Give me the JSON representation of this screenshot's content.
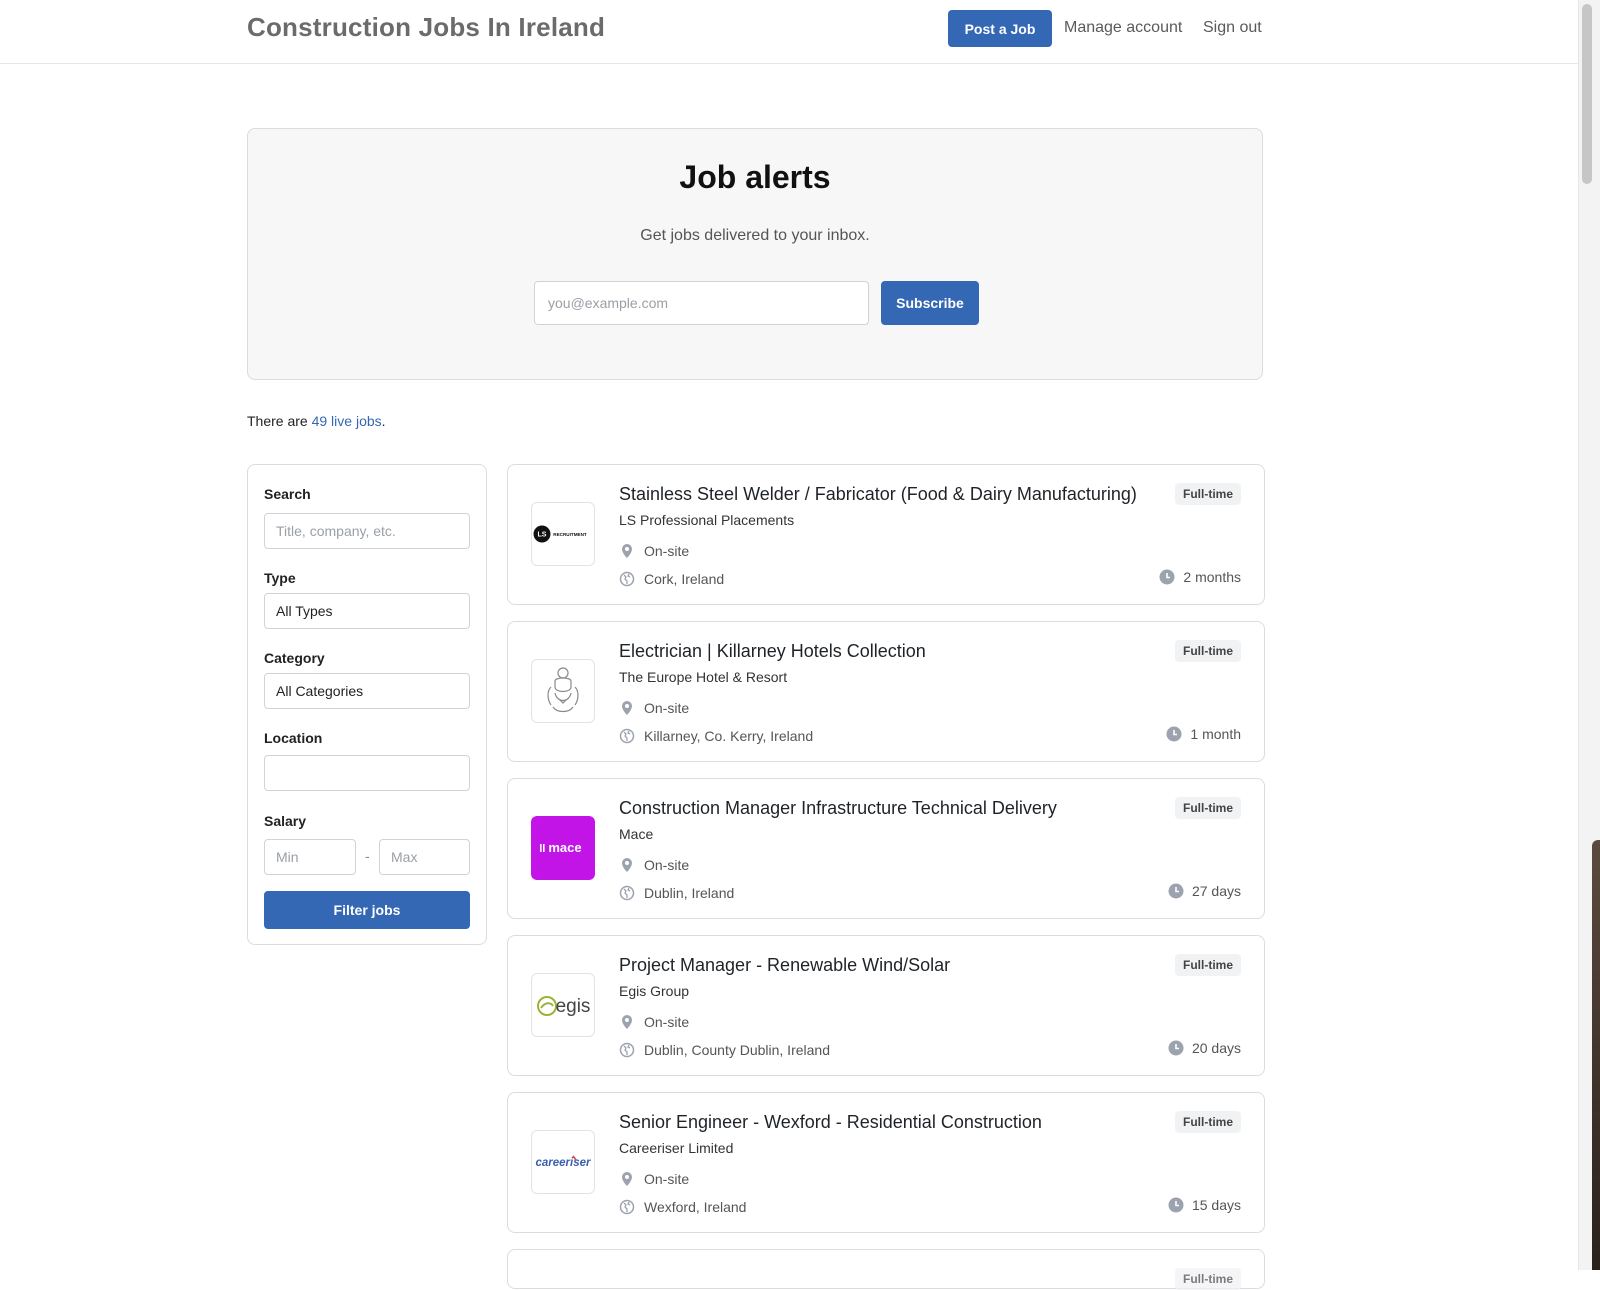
{
  "header": {
    "site_title": "Construction Jobs In Ireland",
    "post_job": "Post a Job",
    "manage_account": "Manage account",
    "sign_out": "Sign out"
  },
  "alerts": {
    "title": "Job alerts",
    "subtitle": "Get jobs delivered to your inbox.",
    "email_placeholder": "you@example.com",
    "subscribe": "Subscribe"
  },
  "summary": {
    "prefix": "There are ",
    "link": "49 live jobs",
    "suffix": "."
  },
  "filters": {
    "search_label": "Search",
    "search_placeholder": "Title, company, etc.",
    "type_label": "Type",
    "type_value": "All Types",
    "category_label": "Category",
    "category_value": "All Categories",
    "location_label": "Location",
    "location_value": "",
    "salary_label": "Salary",
    "min_placeholder": "Min",
    "max_placeholder": "Max",
    "separator": "-",
    "filter_button": "Filter jobs"
  },
  "jobs": [
    {
      "title": "Stainless Steel Welder / Fabricator (Food & Dairy Manufacturing)",
      "company": "LS Professional Placements",
      "workplace": "On-site",
      "location": "Cork, Ireland",
      "type": "Full-time",
      "age": "2 months",
      "logo_text": "LS RECRUITMENT"
    },
    {
      "title": "Electrician | Killarney Hotels Collection",
      "company": "The Europe Hotel & Resort",
      "workplace": "On-site",
      "location": "Killarney, Co. Kerry, Ireland",
      "type": "Full-time",
      "age": "1 month"
    },
    {
      "title": "Construction Manager Infrastructure Technical Delivery",
      "company": "Mace",
      "workplace": "On-site",
      "location": "Dublin, Ireland",
      "type": "Full-time",
      "age": "27 days",
      "logo_text": "mace",
      "logo_color": "#c314e8"
    },
    {
      "title": "Project Manager - Renewable Wind/Solar",
      "company": "Egis Group",
      "workplace": "On-site",
      "location": "Dublin, County Dublin, Ireland",
      "type": "Full-time",
      "age": "20 days",
      "logo_text": "egis"
    },
    {
      "title": "Senior Engineer - Wexford - Residential Construction",
      "company": "Careeriser Limited",
      "workplace": "On-site",
      "location": "Wexford, Ireland",
      "type": "Full-time",
      "age": "15 days",
      "logo_text": "careeriser"
    },
    {
      "type": "Full-time"
    }
  ],
  "colors": {
    "accent": "#3467b4",
    "mace_purple": "#c314e8"
  },
  "icons": {
    "workplace": "map-pin-icon",
    "location": "globe-icon",
    "age": "clock-icon"
  }
}
